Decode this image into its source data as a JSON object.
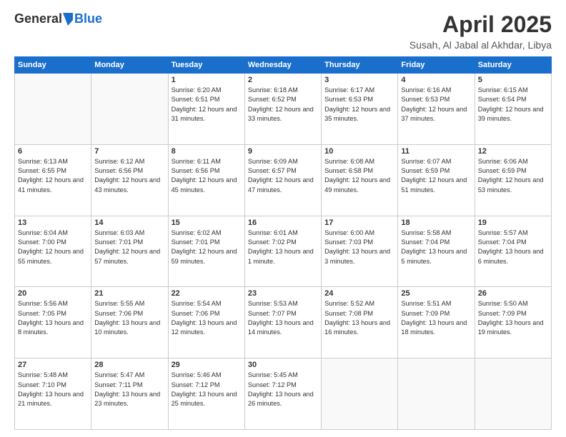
{
  "header": {
    "logo_general": "General",
    "logo_blue": "Blue",
    "month_title": "April 2025",
    "location": "Susah, Al Jabal al Akhdar, Libya"
  },
  "weekdays": [
    "Sunday",
    "Monday",
    "Tuesday",
    "Wednesday",
    "Thursday",
    "Friday",
    "Saturday"
  ],
  "weeks": [
    [
      {
        "day": "",
        "empty": true
      },
      {
        "day": "",
        "empty": true
      },
      {
        "day": "1",
        "sunrise": "6:20 AM",
        "sunset": "6:51 PM",
        "daylight": "12 hours and 31 minutes."
      },
      {
        "day": "2",
        "sunrise": "6:18 AM",
        "sunset": "6:52 PM",
        "daylight": "12 hours and 33 minutes."
      },
      {
        "day": "3",
        "sunrise": "6:17 AM",
        "sunset": "6:53 PM",
        "daylight": "12 hours and 35 minutes."
      },
      {
        "day": "4",
        "sunrise": "6:16 AM",
        "sunset": "6:53 PM",
        "daylight": "12 hours and 37 minutes."
      },
      {
        "day": "5",
        "sunrise": "6:15 AM",
        "sunset": "6:54 PM",
        "daylight": "12 hours and 39 minutes."
      }
    ],
    [
      {
        "day": "6",
        "sunrise": "6:13 AM",
        "sunset": "6:55 PM",
        "daylight": "12 hours and 41 minutes."
      },
      {
        "day": "7",
        "sunrise": "6:12 AM",
        "sunset": "6:56 PM",
        "daylight": "12 hours and 43 minutes."
      },
      {
        "day": "8",
        "sunrise": "6:11 AM",
        "sunset": "6:56 PM",
        "daylight": "12 hours and 45 minutes."
      },
      {
        "day": "9",
        "sunrise": "6:09 AM",
        "sunset": "6:57 PM",
        "daylight": "12 hours and 47 minutes."
      },
      {
        "day": "10",
        "sunrise": "6:08 AM",
        "sunset": "6:58 PM",
        "daylight": "12 hours and 49 minutes."
      },
      {
        "day": "11",
        "sunrise": "6:07 AM",
        "sunset": "6:59 PM",
        "daylight": "12 hours and 51 minutes."
      },
      {
        "day": "12",
        "sunrise": "6:06 AM",
        "sunset": "6:59 PM",
        "daylight": "12 hours and 53 minutes."
      }
    ],
    [
      {
        "day": "13",
        "sunrise": "6:04 AM",
        "sunset": "7:00 PM",
        "daylight": "12 hours and 55 minutes."
      },
      {
        "day": "14",
        "sunrise": "6:03 AM",
        "sunset": "7:01 PM",
        "daylight": "12 hours and 57 minutes."
      },
      {
        "day": "15",
        "sunrise": "6:02 AM",
        "sunset": "7:01 PM",
        "daylight": "12 hours and 59 minutes."
      },
      {
        "day": "16",
        "sunrise": "6:01 AM",
        "sunset": "7:02 PM",
        "daylight": "13 hours and 1 minute."
      },
      {
        "day": "17",
        "sunrise": "6:00 AM",
        "sunset": "7:03 PM",
        "daylight": "13 hours and 3 minutes."
      },
      {
        "day": "18",
        "sunrise": "5:58 AM",
        "sunset": "7:04 PM",
        "daylight": "13 hours and 5 minutes."
      },
      {
        "day": "19",
        "sunrise": "5:57 AM",
        "sunset": "7:04 PM",
        "daylight": "13 hours and 6 minutes."
      }
    ],
    [
      {
        "day": "20",
        "sunrise": "5:56 AM",
        "sunset": "7:05 PM",
        "daylight": "13 hours and 8 minutes."
      },
      {
        "day": "21",
        "sunrise": "5:55 AM",
        "sunset": "7:06 PM",
        "daylight": "13 hours and 10 minutes."
      },
      {
        "day": "22",
        "sunrise": "5:54 AM",
        "sunset": "7:06 PM",
        "daylight": "13 hours and 12 minutes."
      },
      {
        "day": "23",
        "sunrise": "5:53 AM",
        "sunset": "7:07 PM",
        "daylight": "13 hours and 14 minutes."
      },
      {
        "day": "24",
        "sunrise": "5:52 AM",
        "sunset": "7:08 PM",
        "daylight": "13 hours and 16 minutes."
      },
      {
        "day": "25",
        "sunrise": "5:51 AM",
        "sunset": "7:09 PM",
        "daylight": "13 hours and 18 minutes."
      },
      {
        "day": "26",
        "sunrise": "5:50 AM",
        "sunset": "7:09 PM",
        "daylight": "13 hours and 19 minutes."
      }
    ],
    [
      {
        "day": "27",
        "sunrise": "5:48 AM",
        "sunset": "7:10 PM",
        "daylight": "13 hours and 21 minutes."
      },
      {
        "day": "28",
        "sunrise": "5:47 AM",
        "sunset": "7:11 PM",
        "daylight": "13 hours and 23 minutes."
      },
      {
        "day": "29",
        "sunrise": "5:46 AM",
        "sunset": "7:12 PM",
        "daylight": "13 hours and 25 minutes."
      },
      {
        "day": "30",
        "sunrise": "5:45 AM",
        "sunset": "7:12 PM",
        "daylight": "13 hours and 26 minutes."
      },
      {
        "day": "",
        "empty": true
      },
      {
        "day": "",
        "empty": true
      },
      {
        "day": "",
        "empty": true
      }
    ]
  ],
  "labels": {
    "sunrise": "Sunrise:",
    "sunset": "Sunset:",
    "daylight": "Daylight:"
  }
}
